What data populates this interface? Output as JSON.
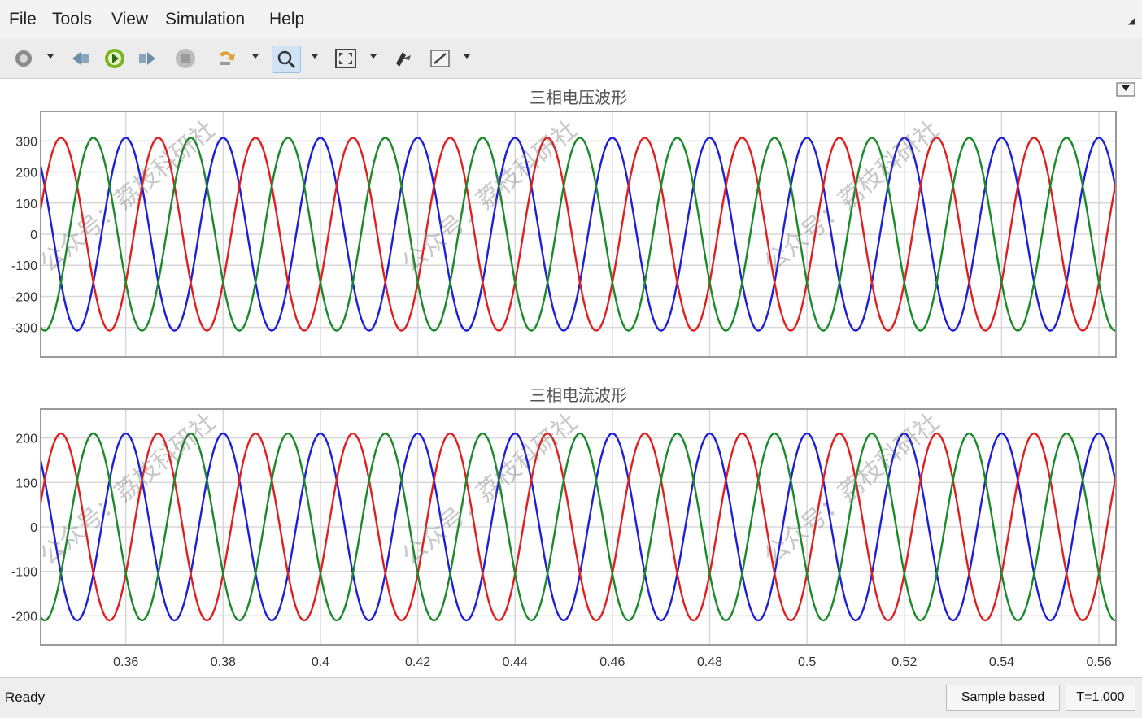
{
  "menu": [
    "File",
    "Tools",
    "View",
    "Simulation",
    "Help"
  ],
  "colors": {
    "phase_a": "#1f1fd8",
    "phase_b": "#e02020",
    "phase_c": "#1a8a2a",
    "grid": "#d8d8d8",
    "axes": "#999999"
  },
  "toolbar": [
    {
      "name": "settings-icon",
      "dropdown": true
    },
    {
      "name": "step-back-icon"
    },
    {
      "name": "run-icon"
    },
    {
      "name": "step-forward-icon"
    },
    {
      "name": "stop-icon"
    },
    {
      "name": "highlight-icon",
      "dropdown": true
    },
    {
      "name": "zoom-icon",
      "dropdown": true,
      "active": true
    },
    {
      "name": "fit-to-view-icon",
      "dropdown": true
    },
    {
      "name": "cursor-measure-icon"
    },
    {
      "name": "edit-style-icon",
      "dropdown": true
    }
  ],
  "chart_data": [
    {
      "type": "line",
      "title": "三相电压波形",
      "xlim": [
        0.3425,
        0.5635
      ],
      "ylim": [
        -395,
        395
      ],
      "yticks": [
        300,
        200,
        100,
        0,
        -100,
        -200,
        -300
      ],
      "ytick_labels": [
        "300",
        "200",
        "100",
        "0",
        "-100",
        "-200",
        "-300"
      ],
      "grid": true,
      "series": [
        {
          "amplitude": 310,
          "frequency_hz": 50,
          "phase_deg": 0,
          "color": "#1f1fd8"
        },
        {
          "amplitude": 310,
          "frequency_hz": 50,
          "phase_deg": -120,
          "color": "#e02020"
        },
        {
          "amplitude": 310,
          "frequency_hz": 50,
          "phase_deg": 120,
          "color": "#1a8a2a"
        }
      ]
    },
    {
      "type": "line",
      "title": "三相电流波形",
      "xlim": [
        0.3425,
        0.5635
      ],
      "ylim": [
        -265,
        265
      ],
      "yticks": [
        200,
        100,
        0,
        -100,
        -200
      ],
      "ytick_labels": [
        "200",
        "100",
        "0",
        "-100",
        "-200"
      ],
      "xticks": [
        0.36,
        0.38,
        0.4,
        0.42,
        0.44,
        0.46,
        0.48,
        0.5,
        0.52,
        0.54,
        0.56
      ],
      "xtick_labels": [
        "0.36",
        "0.38",
        "0.4",
        "0.42",
        "0.44",
        "0.46",
        "0.48",
        "0.5",
        "0.52",
        "0.54",
        "0.56"
      ],
      "grid": true,
      "series": [
        {
          "amplitude": 210,
          "frequency_hz": 50,
          "phase_deg": 0,
          "color": "#1f1fd8"
        },
        {
          "amplitude": 210,
          "frequency_hz": 50,
          "phase_deg": -120,
          "color": "#e02020"
        },
        {
          "amplitude": 210,
          "frequency_hz": 50,
          "phase_deg": 120,
          "color": "#1a8a2a"
        }
      ]
    }
  ],
  "watermark": "公众号：荔枝科研社",
  "status": {
    "text": "Ready",
    "sample_mode": "Sample based",
    "time": "T=1.000"
  }
}
